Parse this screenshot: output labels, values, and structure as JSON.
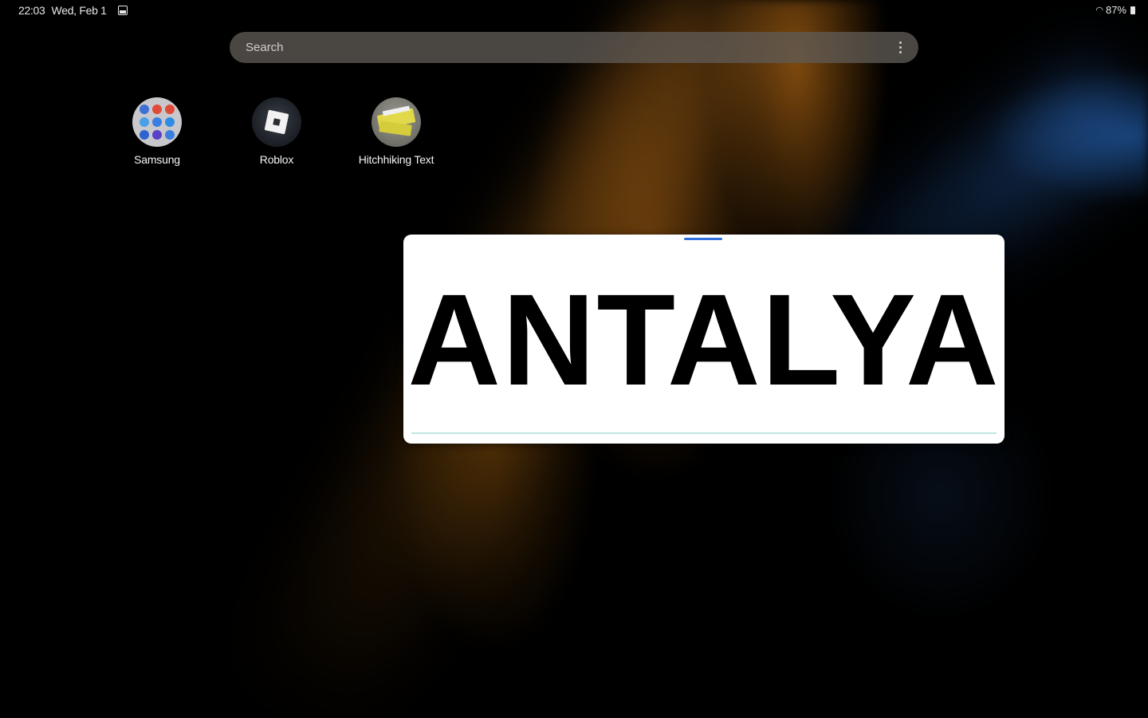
{
  "status_bar": {
    "time": "22:03",
    "date": "Wed, Feb 1",
    "battery": "87%",
    "icons": [
      "gallery-icon",
      "wifi-icon",
      "battery-icon"
    ]
  },
  "search": {
    "placeholder": "Search",
    "value": ""
  },
  "apps": [
    {
      "label": "Samsung",
      "icon": "folder-icon"
    },
    {
      "label": "Roblox",
      "icon": "roblox-icon"
    },
    {
      "label": "Hitchhiking Text",
      "icon": "hitchhiking-text-icon"
    }
  ],
  "widget": {
    "text": "ANTALYA"
  },
  "colors": {
    "widget_handle": "#2f6fe0",
    "widget_underline": "#bfe6e2",
    "wallpaper_accent": "#b06a12",
    "wallpaper_blue": "#2860b4"
  }
}
